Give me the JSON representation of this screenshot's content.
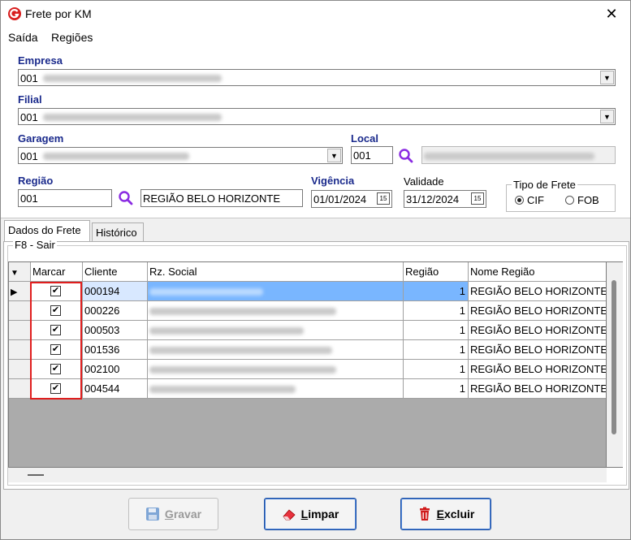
{
  "window": {
    "title": "Frete por KM"
  },
  "menu": {
    "items": [
      "Saída",
      "Regiões"
    ]
  },
  "form": {
    "empresa": {
      "label": "Empresa",
      "code": "001"
    },
    "filial": {
      "label": "Filial",
      "code": "001"
    },
    "garagem": {
      "label": "Garagem",
      "code": "001"
    },
    "local": {
      "label": "Local",
      "code": "001"
    },
    "regiao": {
      "label": "Região",
      "code": "001",
      "name": "REGIÃO BELO HORIZONTE"
    },
    "vigencia": {
      "label": "Vigência",
      "value": "01/01/2024"
    },
    "validade": {
      "label": "Validade",
      "value": "31/12/2024"
    },
    "tipo_frete": {
      "label": "Tipo de Frete",
      "options": [
        "CIF",
        "FOB"
      ],
      "selected": "CIF"
    }
  },
  "tabs": [
    "Dados do Frete",
    "Histórico"
  ],
  "grid": {
    "group_label": "F8 - Sair",
    "columns": [
      "Marcar",
      "Cliente",
      "Rz. Social",
      "Região",
      "Nome Região"
    ],
    "rows": [
      {
        "marcar": true,
        "cliente": "000194",
        "regiao": "1",
        "nome_regiao": "REGIÃO BELO HORIZONTE"
      },
      {
        "marcar": true,
        "cliente": "000226",
        "regiao": "1",
        "nome_regiao": "REGIÃO BELO HORIZONTE"
      },
      {
        "marcar": true,
        "cliente": "000503",
        "regiao": "1",
        "nome_regiao": "REGIÃO BELO HORIZONTE"
      },
      {
        "marcar": true,
        "cliente": "001536",
        "regiao": "1",
        "nome_regiao": "REGIÃO BELO HORIZONTE"
      },
      {
        "marcar": true,
        "cliente": "002100",
        "regiao": "1",
        "nome_regiao": "REGIÃO BELO HORIZONTE"
      },
      {
        "marcar": true,
        "cliente": "004544",
        "regiao": "1",
        "nome_regiao": "REGIÃO BELO HORIZONTE"
      }
    ]
  },
  "buttons": {
    "gravar": {
      "label_first": "G",
      "label_rest": "ravar"
    },
    "limpar": {
      "label_first": "L",
      "label_rest": "impar"
    },
    "excluir": {
      "label_first": "E",
      "label_rest": "xcluir"
    }
  },
  "colors": {
    "label_blue": "#1a2a8c",
    "highlight": "#e01e1e",
    "selection": "#3399ff"
  }
}
